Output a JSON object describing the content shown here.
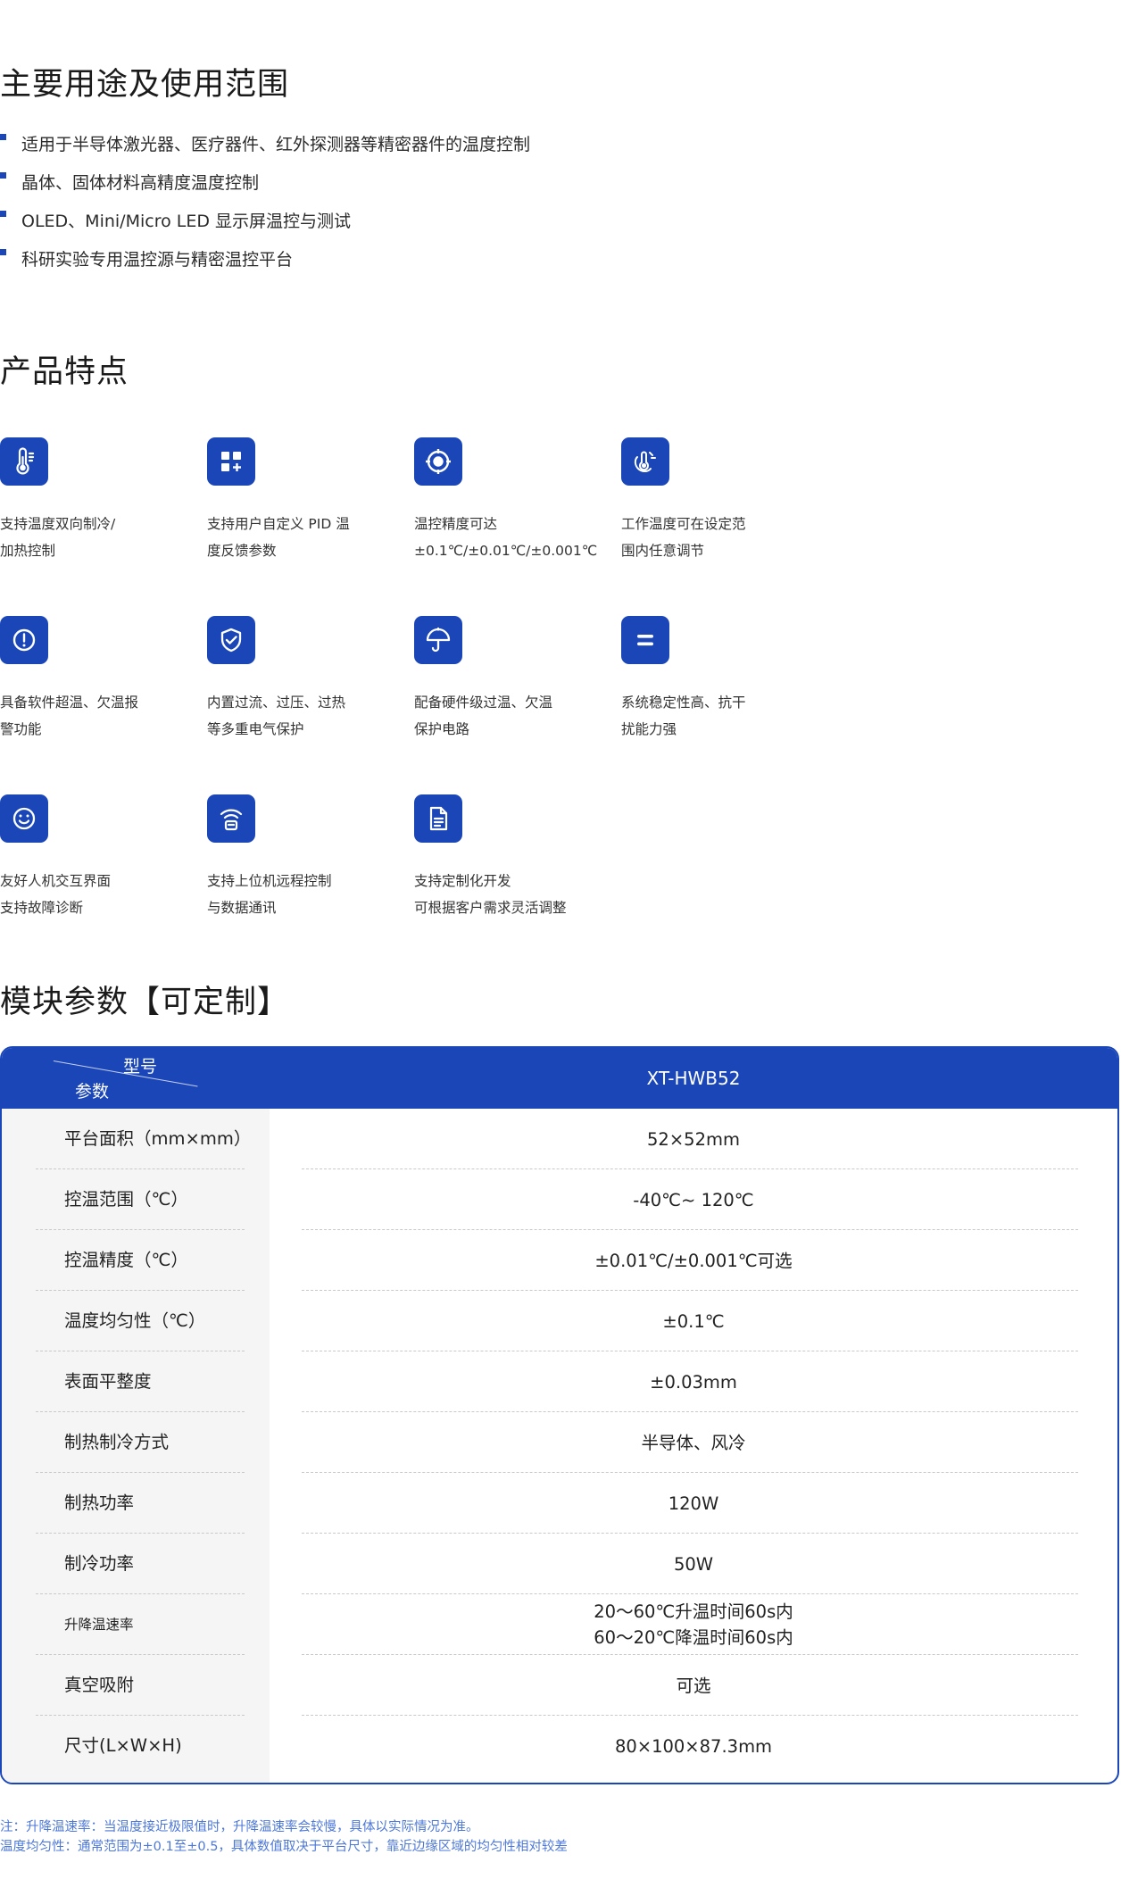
{
  "uses": {
    "title": "主要用途及使用范围",
    "items": [
      "适用于半导体激光器、医疗器件、红外探测器等精密器件的温度控制",
      "晶体、固体材料高精度温度控制",
      "OLED、Mini/Micro LED 显示屏温控与测试",
      "科研实验专用温控源与精密温控平台"
    ]
  },
  "features": {
    "title": "产品特点",
    "items": [
      {
        "icon": "thermometer-icon",
        "lines": [
          "支持温度双向制冷/",
          "加热控制"
        ]
      },
      {
        "icon": "custom-grid-plus-icon",
        "lines": [
          "支持用户自定义 PID 温",
          "度反馈参数"
        ]
      },
      {
        "icon": "precision-target-icon",
        "lines": [
          "温控精度可达",
          "±0.1℃/±0.01℃/±0.001℃"
        ]
      },
      {
        "icon": "hand-temperature-icon",
        "lines": [
          "工作温度可在设定范",
          "围内任意调节"
        ]
      },
      {
        "icon": "alert-circle-icon",
        "lines": [
          "具备软件超温、欠温报",
          "警功能"
        ]
      },
      {
        "icon": "shield-check-icon",
        "lines": [
          "内置过流、过压、过热",
          "等多重电气保护"
        ]
      },
      {
        "icon": "umbrella-icon",
        "lines": [
          "配备硬件级过温、欠温",
          "保护电路"
        ]
      },
      {
        "icon": "equals-icon",
        "lines": [
          "系统稳定性高、抗干",
          "扰能力强"
        ]
      },
      {
        "icon": "smiley-icon",
        "lines": [
          "友好人机交互界面",
          "支持故障诊断"
        ]
      },
      {
        "icon": "remote-signal-icon",
        "lines": [
          "支持上位机远程控制",
          "与数据通讯"
        ]
      },
      {
        "icon": "document-icon",
        "lines": [
          "支持定制化开发",
          "可根据客户需求灵活调整"
        ]
      }
    ]
  },
  "params": {
    "title": "模块参数【可定制】",
    "header_model": "型号",
    "header_param": "参数",
    "model_name": "XT-HWB52",
    "rows": [
      {
        "label": "平台面积（mm×mm）",
        "value": [
          "52×52mm"
        ]
      },
      {
        "label": "控温范围（℃）",
        "value": [
          "-40℃~ 120℃"
        ]
      },
      {
        "label": "控温精度（℃）",
        "value": [
          "±0.01℃/±0.001℃可选"
        ]
      },
      {
        "label": "温度均匀性（℃）",
        "value": [
          "±0.1℃"
        ]
      },
      {
        "label": "表面平整度",
        "value": [
          "±0.03mm"
        ]
      },
      {
        "label": "制热制冷方式",
        "value": [
          "半导体、风冷"
        ]
      },
      {
        "label": "制热功率",
        "value": [
          "120W"
        ]
      },
      {
        "label": "制冷功率",
        "value": [
          "50W"
        ]
      },
      {
        "label": "升降温速率",
        "value": [
          "20～60℃升温时间60s内",
          "60～20℃降温时间60s内"
        ]
      },
      {
        "label": "真空吸附",
        "value": [
          "可选"
        ]
      },
      {
        "label": "尺寸(L×W×H)",
        "value": [
          "80×100×87.3mm"
        ]
      }
    ]
  },
  "notes": [
    "注：升降温速率：当温度接近极限值时，升降温速率会较慢，具体以实际情况为准。",
    "温度均匀性：通常范围为±0.1至±0.5，具体数值取决于平台尺寸，靠近边缘区域的均匀性相对较差"
  ],
  "colors": {
    "accent": "#1a46b8",
    "note": "#4d78d8",
    "label_bg": "#f5f5f5"
  }
}
